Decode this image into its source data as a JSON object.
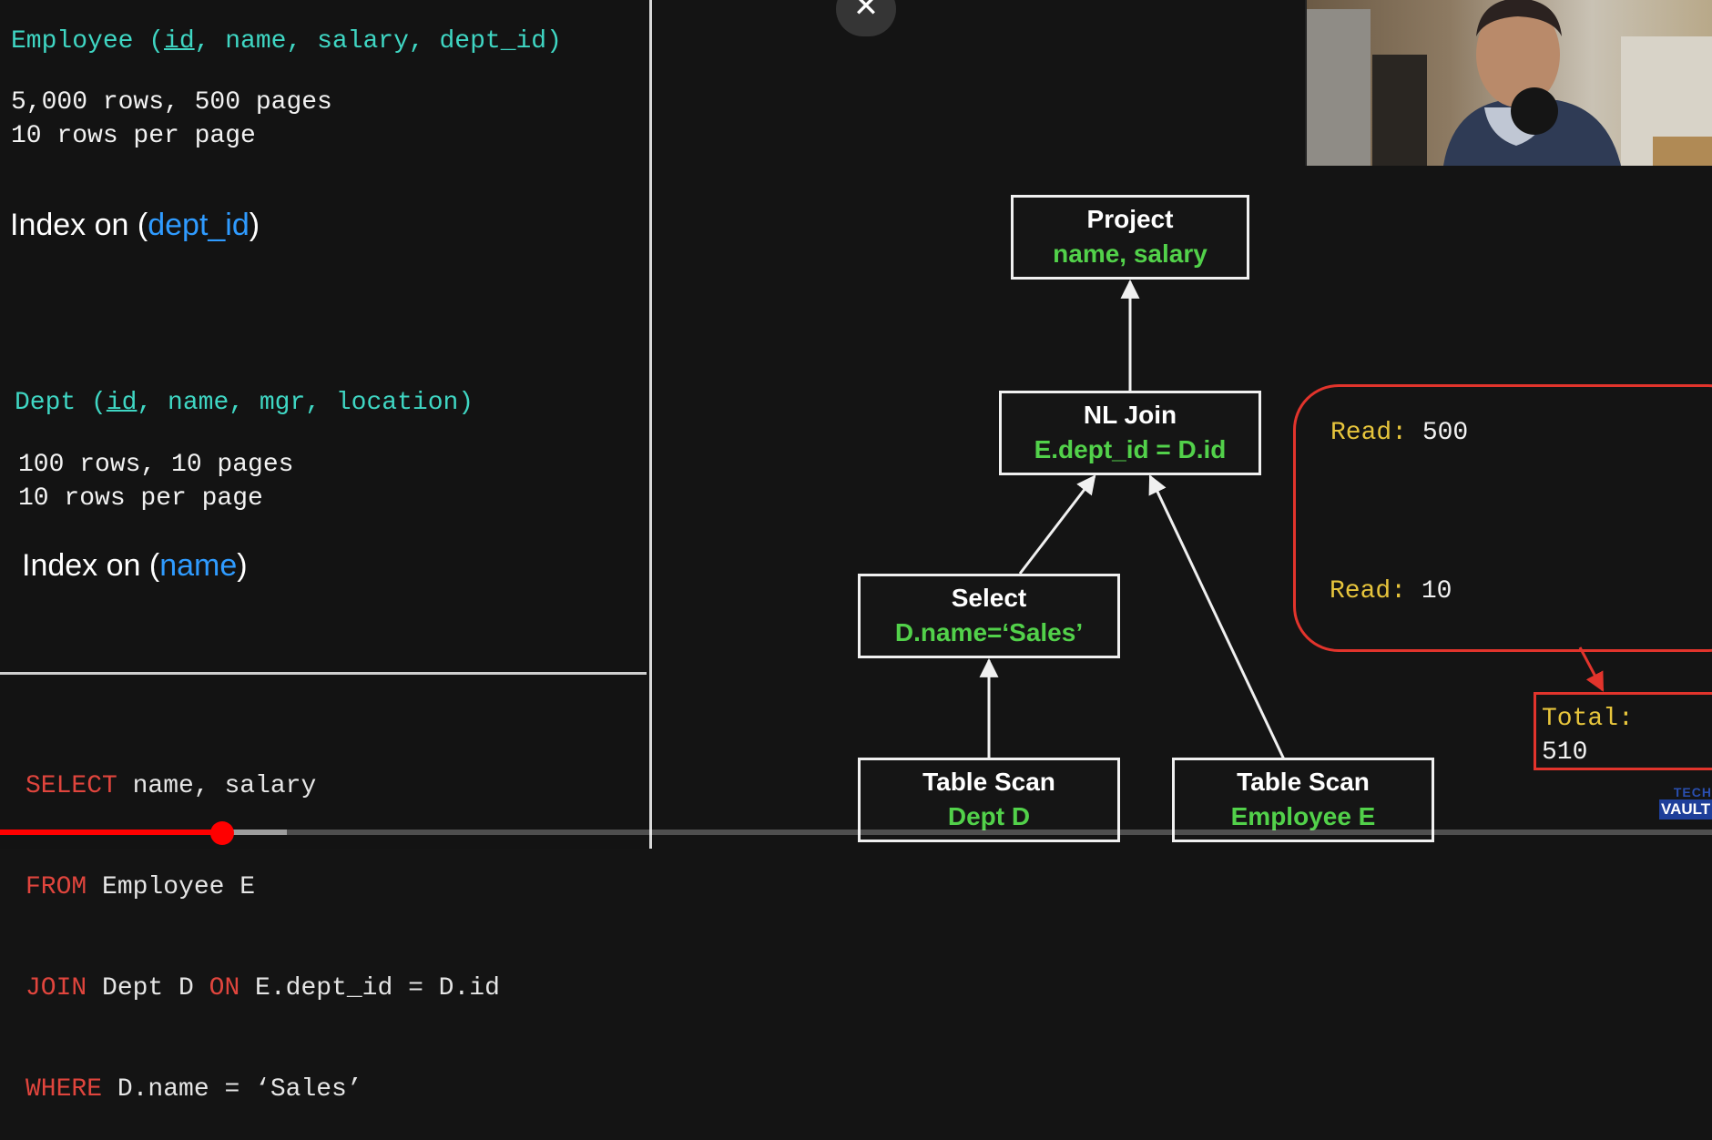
{
  "left": {
    "employee": {
      "table": "Employee",
      "cols_pre": " (",
      "key": "id",
      "cols_post": ", name, salary, dept_id)",
      "rows": "5,000 rows, 500 pages",
      "per_page": "10 rows per page",
      "index_prefix": "Index on (",
      "index_col": "dept_id",
      "index_suffix": ")"
    },
    "dept": {
      "table": "Dept",
      "cols_pre": " (",
      "key": "id",
      "cols_post": ", name, mgr, location)",
      "rows": "100 rows, 10 pages",
      "per_page": "10 rows per page",
      "index_prefix": "Index on (",
      "index_col": "name",
      "index_suffix": ")"
    },
    "sql": {
      "l1_kw": "SELECT",
      "l1_rest": " name, salary",
      "l2_kw": "FROM",
      "l2_rest": " Employee E",
      "l3_kw": "JOIN",
      "l3_mid": " Dept D ",
      "l3_kw2": "ON",
      "l3_rest": " E.dept_id = D.id",
      "l4_kw": "WHERE",
      "l4_rest": " D.name = ‘Sales’"
    }
  },
  "close_icon": "close-icon",
  "plan": {
    "project": {
      "title": "Project",
      "detail": "name, salary"
    },
    "nl_join": {
      "title": "NL Join",
      "detail": "E.dept_id = D.id"
    },
    "select": {
      "title": "Select",
      "detail": "D.name=‘Sales’"
    },
    "scan_dept": {
      "title": "Table Scan",
      "detail": "Dept D"
    },
    "scan_emp": {
      "title": "Table Scan",
      "detail": "Employee E"
    }
  },
  "cost": {
    "read1_label": "Read:",
    "read1_value": " 500",
    "read2_label": "Read:",
    "read2_value": " 10",
    "total_label": "Total:",
    "total_value": "510"
  },
  "logo": {
    "line1": "TECH",
    "line2": "VAULT"
  },
  "video": {
    "progress": 0.13
  },
  "colors": {
    "teal": "#3fd6c3",
    "blue": "#2f9bff",
    "green": "#52d14a",
    "red": "#e2342c",
    "yellow": "#e7c53c"
  }
}
